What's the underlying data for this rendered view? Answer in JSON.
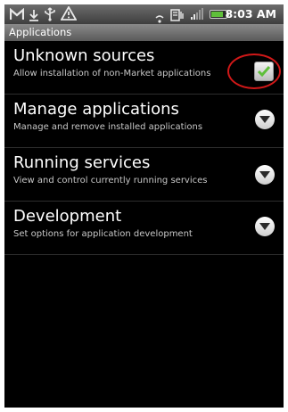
{
  "status_bar": {
    "notification_icons": [
      "gmail-icon",
      "download-icon",
      "usb-icon",
      "warning-icon"
    ],
    "system_icons": [
      "wifi-icon",
      "data-icon",
      "signal-icon",
      "battery-icon"
    ],
    "time": "8:03 AM",
    "battery_level": 0.8
  },
  "header": {
    "title": "Applications"
  },
  "settings": {
    "items": [
      {
        "title": "Unknown sources",
        "summary": "Allow installation of non-Market applications",
        "control": "checkbox",
        "checked": true
      },
      {
        "title": "Manage applications",
        "summary": "Manage and remove installed applications",
        "control": "chevron"
      },
      {
        "title": "Running services",
        "summary": "View and control currently running services",
        "control": "chevron"
      },
      {
        "title": "Development",
        "summary": "Set options for application development",
        "control": "chevron"
      }
    ]
  },
  "colors": {
    "background": "#000000",
    "title_text": "#ffffff",
    "summary_text": "#c8c8c8",
    "check_green": "#5fbf3a",
    "highlight_ring": "#d01818"
  }
}
